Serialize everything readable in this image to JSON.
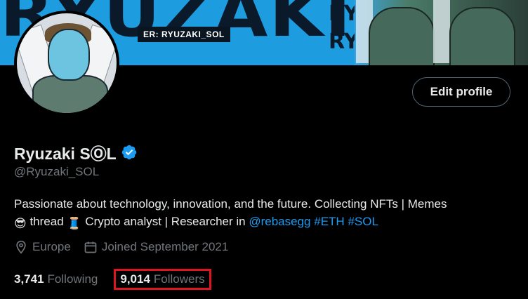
{
  "banner": {
    "big_text": "RYUZAKI",
    "tag_text": "ER: RYUZAKI_SOL",
    "side_text": "RY\nRY"
  },
  "profile": {
    "edit_button_label": "Edit profile",
    "display_name": "Ryuzaki SⓄL",
    "handle": "@Ryuzaki_SOL",
    "bio": {
      "line1": "Passionate about technology, innovation, and the future. Collecting NFTs | Memes",
      "emoji_cool": "😎",
      "thread_word": " thread ",
      "emoji_thread": "🧵",
      "line2_rest": " Crypto analyst | Researcher in ",
      "mention": "@rebasegg",
      "hashtag1": "#ETH",
      "hashtag2": "#SOL"
    },
    "location": "Europe",
    "joined": "Joined September 2021",
    "following_count": "3,741",
    "following_label": "Following",
    "followers_count": "9,014",
    "followers_label": "Followers"
  },
  "colors": {
    "accent": "#1d9bf0",
    "highlight_box": "#e0141e",
    "muted": "#71767b"
  }
}
